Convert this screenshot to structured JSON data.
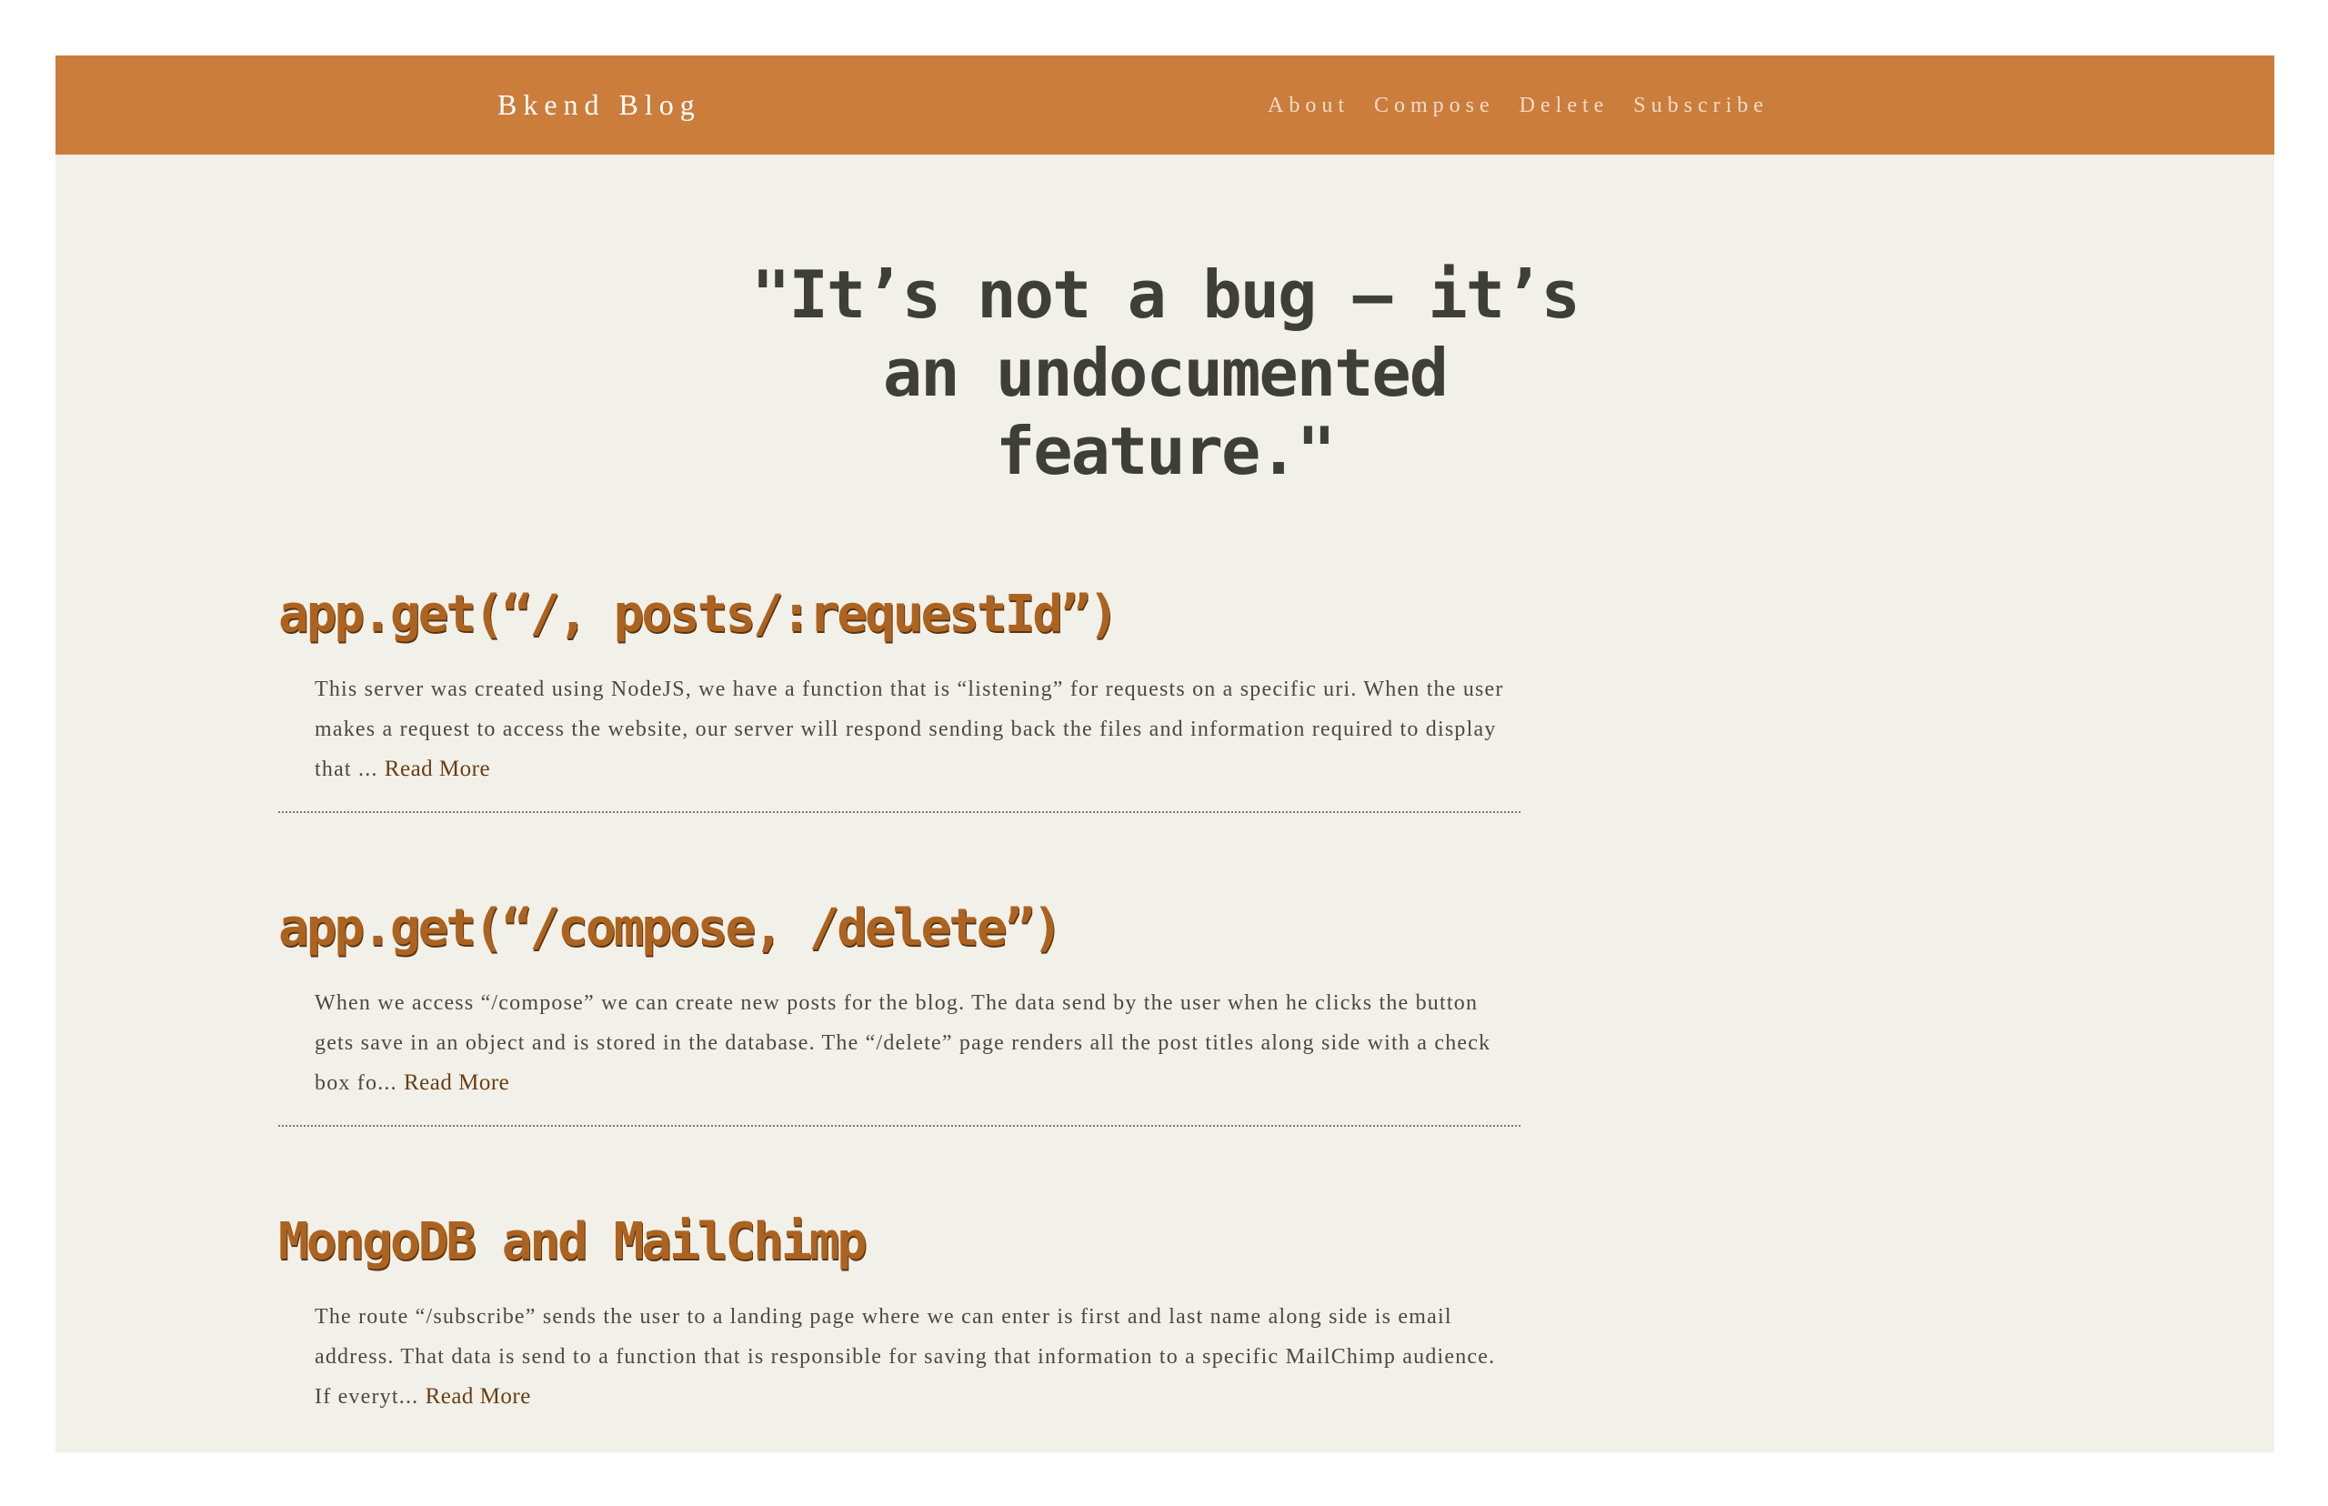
{
  "navbar": {
    "brand": "Bkend Blog",
    "links": [
      "About",
      "Compose",
      "Delete",
      "Subscribe"
    ]
  },
  "hero": {
    "quote": "\"It’s not a bug — it’s an undocumented feature.\""
  },
  "posts": [
    {
      "title": "app.get(“/, posts/:requestId”)",
      "excerpt": "This server was created using NodeJS, we have a function that is “listening” for requests on a specific uri. When the user makes a request to access the website, our server will respond sending back the files and information required to display that ... ",
      "read_more": "Read More"
    },
    {
      "title": "app.get(“/compose, /delete”)",
      "excerpt": "When we access “/compose” we can create new posts for the blog. The data send by the user when he clicks the button gets save in an object and is stored in the database. The “/delete” page renders all the post titles along side with a check box fo... ",
      "read_more": "Read More"
    },
    {
      "title": "MongoDB and MailChimp",
      "excerpt": "The route “/subscribe” sends the user to a landing page where we can enter is first and last name along side is email address. That data is send to a function that is responsible for saving that information to a specific MailChimp audience. If everyt... ",
      "read_more": "Read More"
    }
  ],
  "colors": {
    "navbar_bg": "#cb7d3c",
    "page_bg": "#f1f1ea",
    "title_color": "#ad6320",
    "text_color": "#4a4a44"
  }
}
